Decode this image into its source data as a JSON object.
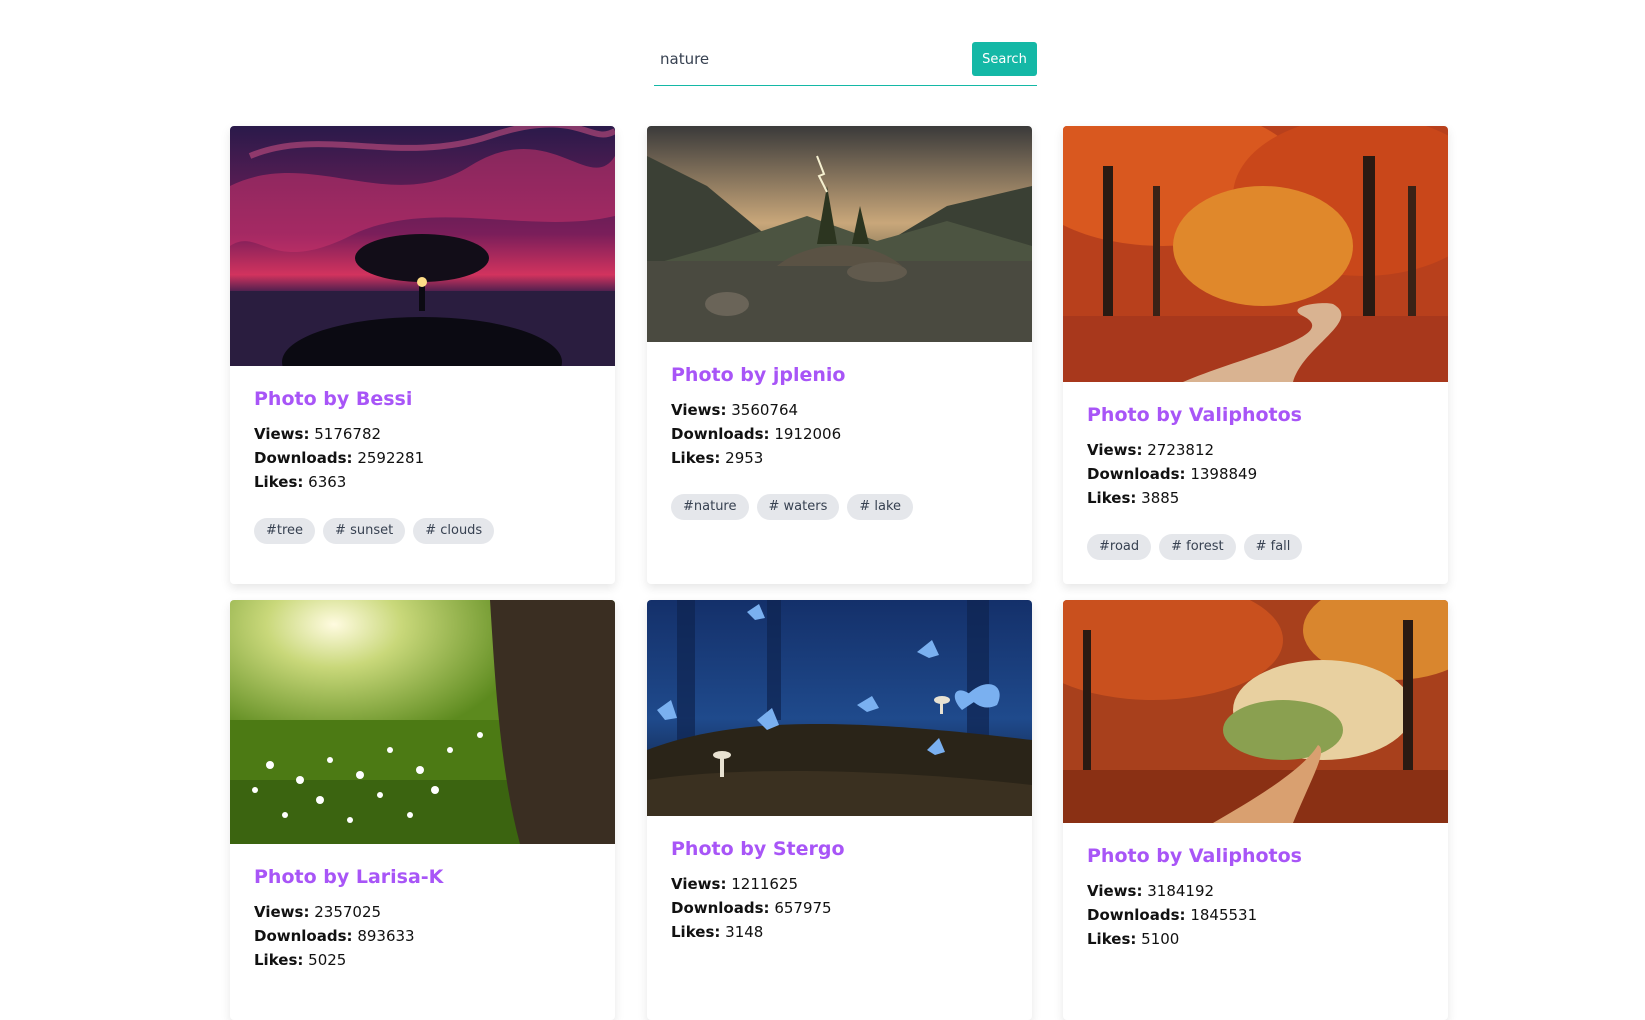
{
  "search": {
    "value": "nature",
    "button_label": "Search"
  },
  "labels": {
    "views": "Views:",
    "downloads": "Downloads:",
    "likes": "Likes:"
  },
  "cards": [
    {
      "title": "Photo by Bessi",
      "views": "5176782",
      "downloads": "2592281",
      "likes": "6363",
      "tags": [
        "#tree",
        "# sunset",
        "# clouds"
      ]
    },
    {
      "title": "Photo by jplenio",
      "views": "3560764",
      "downloads": "1912006",
      "likes": "2953",
      "tags": [
        "#nature",
        "# waters",
        "# lake"
      ]
    },
    {
      "title": "Photo by Valiphotos",
      "views": "2723812",
      "downloads": "1398849",
      "likes": "3885",
      "tags": [
        "#road",
        "# forest",
        "# fall"
      ]
    },
    {
      "title": "Photo by Larisa-K",
      "views": "2357025",
      "downloads": "893633",
      "likes": "5025",
      "tags": []
    },
    {
      "title": "Photo by Stergo",
      "views": "1211625",
      "downloads": "657975",
      "likes": "3148",
      "tags": []
    },
    {
      "title": "Photo by Valiphotos",
      "views": "3184192",
      "downloads": "1845531",
      "likes": "5100",
      "tags": []
    }
  ]
}
